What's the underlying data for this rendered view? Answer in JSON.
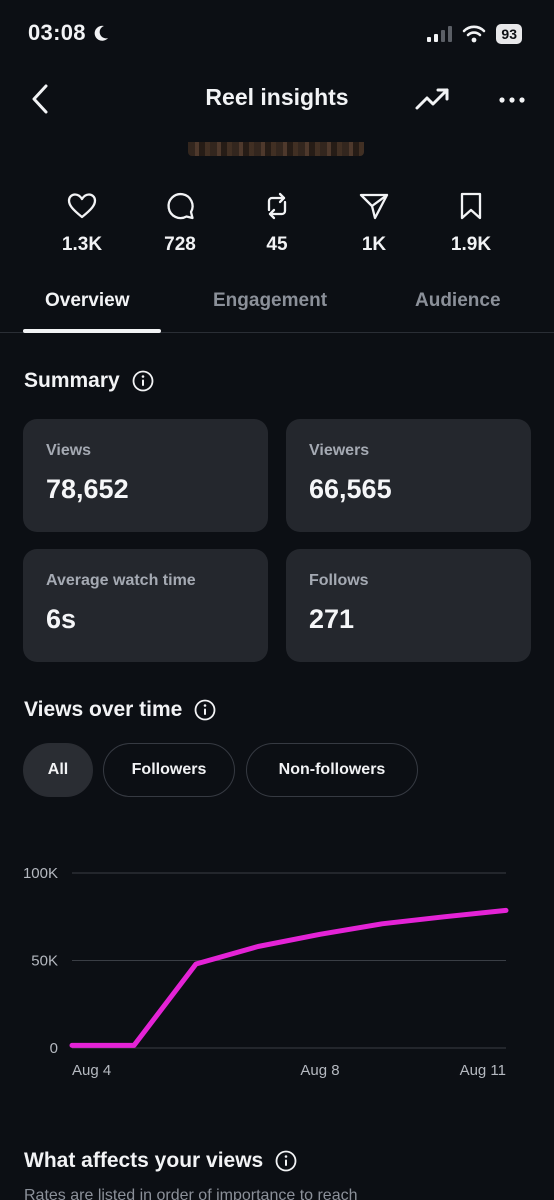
{
  "status_bar": {
    "time": "03:08",
    "battery": "93"
  },
  "header": {
    "title": "Reel insights"
  },
  "stats": [
    {
      "icon": "heart-icon",
      "value": "1.3K"
    },
    {
      "icon": "comment-icon",
      "value": "728"
    },
    {
      "icon": "repost-icon",
      "value": "45"
    },
    {
      "icon": "send-icon",
      "value": "1K"
    },
    {
      "icon": "bookmark-icon",
      "value": "1.9K"
    }
  ],
  "tabs": [
    {
      "label": "Overview"
    },
    {
      "label": "Engagement"
    },
    {
      "label": "Audience"
    }
  ],
  "summary": {
    "title": "Summary",
    "cards": [
      {
        "label": "Views",
        "value": "78,652"
      },
      {
        "label": "Viewers",
        "value": "66,565"
      },
      {
        "label": "Average watch time",
        "value": "6s"
      },
      {
        "label": "Follows",
        "value": "271"
      }
    ]
  },
  "views_over_time": {
    "title": "Views over time",
    "filters": [
      "All",
      "Followers",
      "Non-followers"
    ],
    "selected_filter": "All"
  },
  "chart_data": {
    "type": "line",
    "x": [
      "Aug 4",
      "Aug 5",
      "Aug 6",
      "Aug 7",
      "Aug 8",
      "Aug 9",
      "Aug 10",
      "Aug 11"
    ],
    "series": [
      {
        "values": [
          1500,
          1500,
          48000,
          58000,
          65000,
          71000,
          75000,
          78652
        ],
        "color": "#e423d6"
      }
    ],
    "x_tick_labels": [
      "Aug 4",
      "Aug 8",
      "Aug 11"
    ],
    "y_tick_labels": [
      "100K",
      "50K",
      "0"
    ],
    "y_ticks": [
      100000,
      50000,
      0
    ],
    "ylim": [
      0,
      100000
    ],
    "grid": true
  },
  "what_affects": {
    "title": "What affects your views",
    "subtitle": "Rates are listed in order of importance to reach"
  },
  "colors": {
    "background": "#0c0f14",
    "card": "#24272d",
    "accent_line": "#e423d6",
    "muted_text": "#a5aab3"
  }
}
